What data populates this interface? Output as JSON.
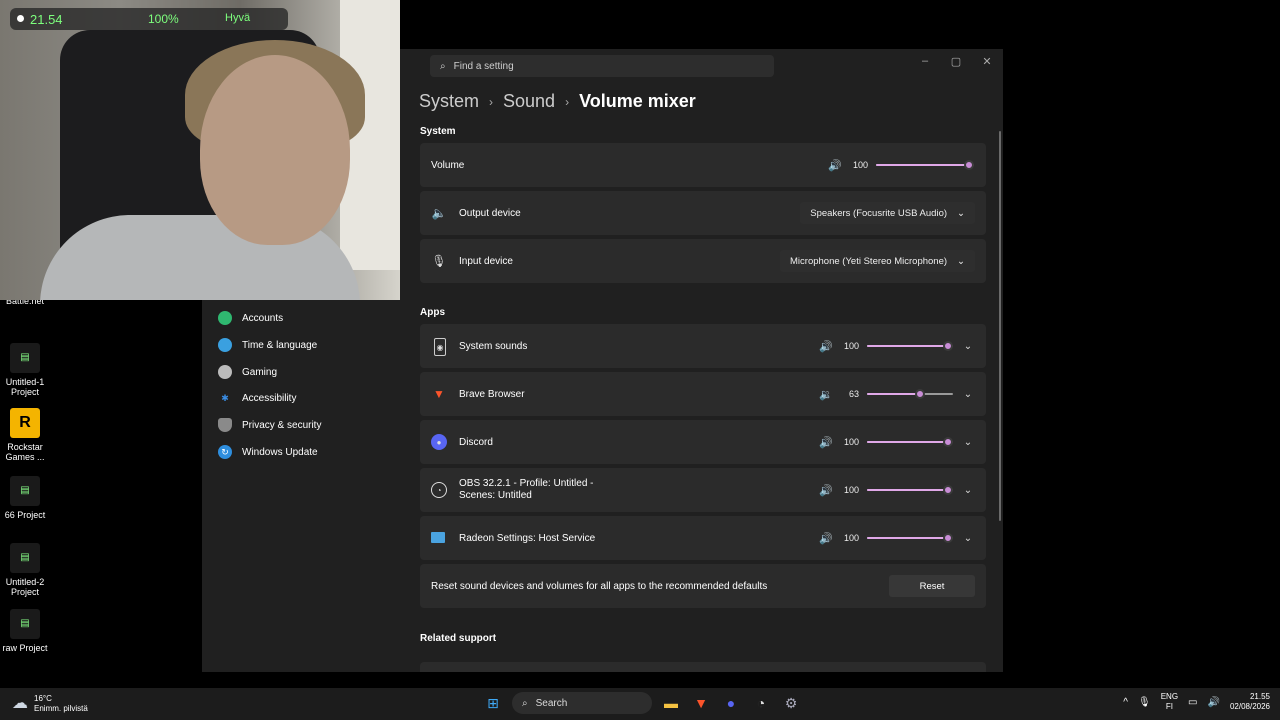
{
  "webcam": {
    "time": "21.54",
    "battery": "100%",
    "status": "Hyvä"
  },
  "desktop": {
    "icons": [
      {
        "label": "Battle.net"
      },
      {
        "label": "Untitled-1 Project"
      },
      {
        "label": "Rockstar Games ..."
      },
      {
        "label": "66 Project"
      },
      {
        "label": "Untitled-2 Project"
      },
      {
        "label": "raw Project"
      }
    ]
  },
  "settings": {
    "search_placeholder": "Find a setting",
    "breadcrumb": {
      "level1": "System",
      "level2": "Sound",
      "current": "Volume mixer",
      "separator": "›"
    },
    "nav": [
      {
        "label": "Accounts",
        "icon": "person-icon",
        "color": "#2fb870"
      },
      {
        "label": "Time & language",
        "icon": "globe-clock-icon",
        "color": "#3aa0e0"
      },
      {
        "label": "Gaming",
        "icon": "gamepad-icon",
        "color": "#bbbbbb"
      },
      {
        "label": "Accessibility",
        "icon": "accessibility-icon",
        "color": "#3a8ee6"
      },
      {
        "label": "Privacy & security",
        "icon": "shield-icon",
        "color": "#8a8a8a"
      },
      {
        "label": "Windows Update",
        "icon": "refresh-icon",
        "color": "#2e8ede"
      }
    ],
    "system_section": {
      "heading": "System",
      "volume": {
        "label": "Volume",
        "value": "100",
        "level": 1.0
      },
      "output": {
        "label": "Output device",
        "value": "Speakers (Focusrite USB Audio)"
      },
      "input": {
        "label": "Input device",
        "value": "Microphone (Yeti Stereo Microphone)"
      }
    },
    "apps_section": {
      "heading": "Apps",
      "apps": [
        {
          "name": "System sounds",
          "icon": "speaker-box-icon",
          "value": "100",
          "level": 1.0
        },
        {
          "name": "Brave Browser",
          "icon": "brave-icon",
          "value": "63",
          "level": 0.63
        },
        {
          "name": "Discord",
          "icon": "discord-icon",
          "value": "100",
          "level": 1.0
        },
        {
          "name": "OBS 32.2.1 - Profile: Untitled - Scenes: Untitled",
          "icon": "obs-icon",
          "value": "100",
          "level": 1.0
        },
        {
          "name": "Radeon Settings: Host Service",
          "icon": "radeon-icon",
          "value": "100",
          "level": 1.0
        }
      ],
      "reset_text": "Reset sound devices and volumes for all apps to the recommended defaults",
      "reset_button": "Reset"
    },
    "related_heading": "Related support"
  },
  "taskbar": {
    "weather_temp": "16°C",
    "weather_desc": "Enimm. pilvistä",
    "search_label": "Search",
    "lang_top": "ENG",
    "lang_bottom": "FI",
    "clock_time": "21.55",
    "clock_date": "02/08/2026"
  },
  "colors": {
    "accent": "#c88cd6",
    "panel": "#2b2b2b",
    "window": "#202020"
  }
}
